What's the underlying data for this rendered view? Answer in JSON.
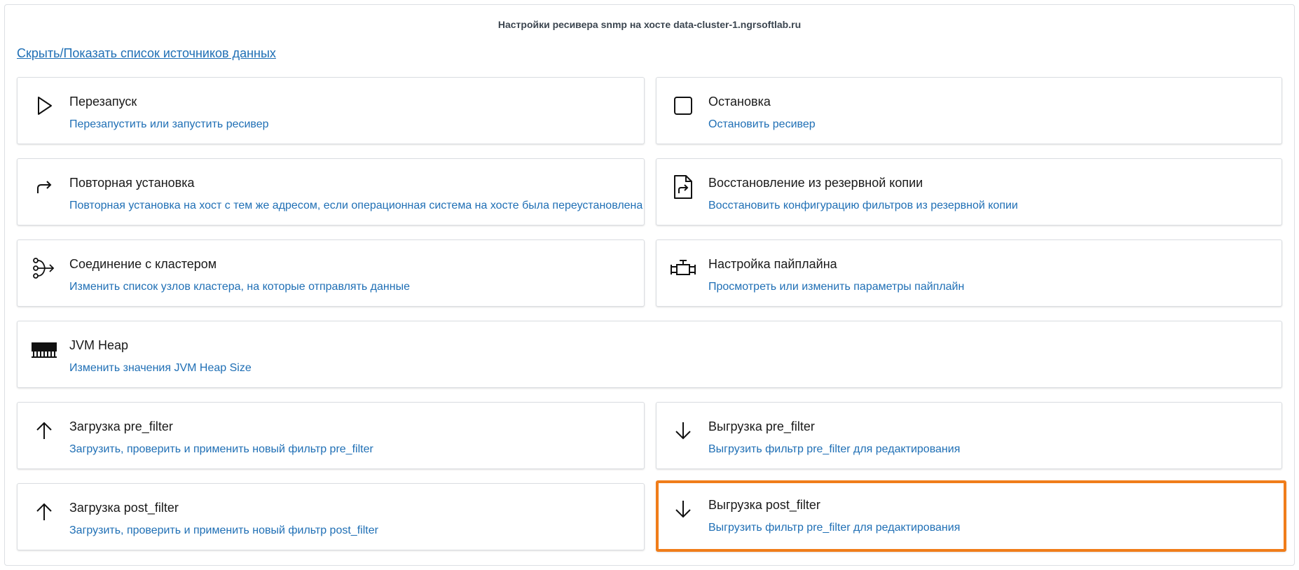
{
  "header": {
    "title": "Настройки ресивера snmp  на хосте data-cluster-1.ngrsoftlab.ru"
  },
  "toggle_link": "Скрыть/Показать список источников данных",
  "cards": {
    "restart": {
      "icon": "play-icon",
      "name": "Перезапуск",
      "desc": "Перезапустить или запустить ресивер"
    },
    "stop": {
      "icon": "stop-icon",
      "name": "Остановка",
      "desc": "Остановить ресивер"
    },
    "reinstall": {
      "icon": "redo-arrow-icon",
      "name": "Повторная установка",
      "desc": "Повторная установка на хост с тем же адресом, если операционная система на хосте была переустановлена"
    },
    "restore": {
      "icon": "file-restore-icon",
      "name": "Восстановление из резервной копии",
      "desc": "Восстановить конфигурацию фильтров из резервной копии"
    },
    "cluster": {
      "icon": "cluster-connection-icon",
      "name": "Соединение с кластером",
      "desc": "Изменить список узлов кластера, на которые отправлять данные"
    },
    "pipeline": {
      "icon": "pipeline-icon",
      "name": "Настройка пайплайна",
      "desc": "Просмотреть или изменить параметры пайплайн"
    },
    "jvm": {
      "icon": "memory-icon",
      "name": "JVM Heap",
      "desc": "Изменить значения JVM Heap Size"
    },
    "upload_pre": {
      "icon": "arrow-up-icon",
      "name": "Загрузка pre_filter",
      "desc": "Загрузить, проверить и применить новый фильтр pre_filter"
    },
    "download_pre": {
      "icon": "arrow-down-icon",
      "name": "Выгрузка pre_filter",
      "desc": "Выгрузить фильтр pre_filter для редактирования"
    },
    "upload_post": {
      "icon": "arrow-up-icon",
      "name": "Загрузка post_filter",
      "desc": "Загрузить, проверить и применить новый фильтр post_filter"
    },
    "download_post": {
      "icon": "arrow-down-icon",
      "name": "Выгрузка post_filter",
      "desc": "Выгрузить фильтр pre_filter для редактирования"
    }
  },
  "colors": {
    "link": "#1f6fb5",
    "highlight": "#f07d1a",
    "border": "#dadde1"
  }
}
